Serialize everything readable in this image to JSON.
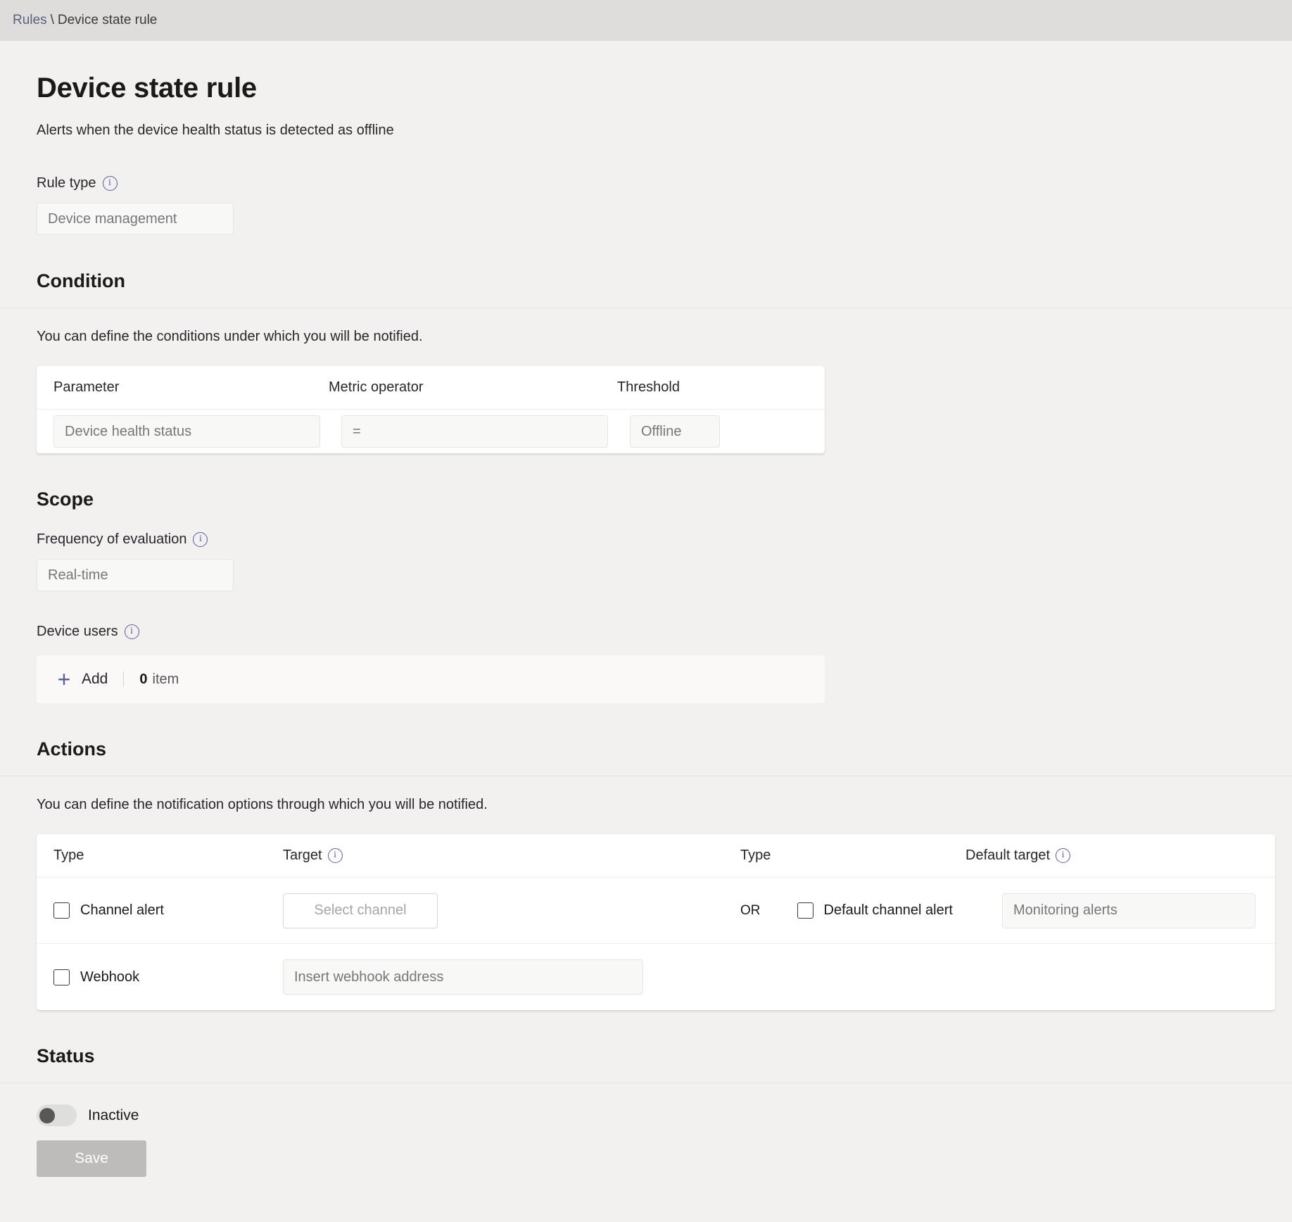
{
  "breadcrumb": {
    "parent": "Rules",
    "separator": "\\",
    "current": "Device state rule"
  },
  "header": {
    "title": "Device state rule",
    "subtitle": "Alerts when the device health status is detected as offline"
  },
  "rule_type": {
    "label": "Rule type",
    "info_icon": "info-icon",
    "value": "Device management"
  },
  "condition": {
    "title": "Condition",
    "description": "You can define the conditions under which you will be notified.",
    "columns": [
      "Parameter",
      "Metric operator",
      "Threshold"
    ],
    "row": {
      "parameter": "Device health status",
      "metric_operator": "=",
      "threshold": "Offline"
    }
  },
  "scope": {
    "title": "Scope",
    "frequency_label": "Frequency of evaluation",
    "frequency_value": "Real-time",
    "device_users_label": "Device users",
    "add_label": "Add",
    "add_icon": "plus-icon",
    "count_number": "0",
    "count_unit": "item"
  },
  "actions": {
    "title": "Actions",
    "description": "You can define the notification options through which you will be notified.",
    "columns": {
      "type_left": "Type",
      "target": "Target",
      "type_right": "Type",
      "default_target": "Default target"
    },
    "or_label": "OR",
    "rows": [
      {
        "left_checkbox_label": "Channel alert",
        "target_button": "Select channel",
        "right_checkbox_label": "Default channel alert",
        "default_target_value": "Monitoring alerts"
      },
      {
        "left_checkbox_label": "Webhook",
        "webhook_placeholder": "Insert webhook address"
      }
    ]
  },
  "status": {
    "title": "Status",
    "toggle_label": "Inactive",
    "toggle_on": false,
    "save_label": "Save"
  },
  "colors": {
    "accent": "#585ca0",
    "breadcrumb_bar": "#dedddc",
    "page_bg": "#f2f1f0",
    "card_bg": "#ffffff",
    "disabled_button": "#bdbcbb"
  }
}
